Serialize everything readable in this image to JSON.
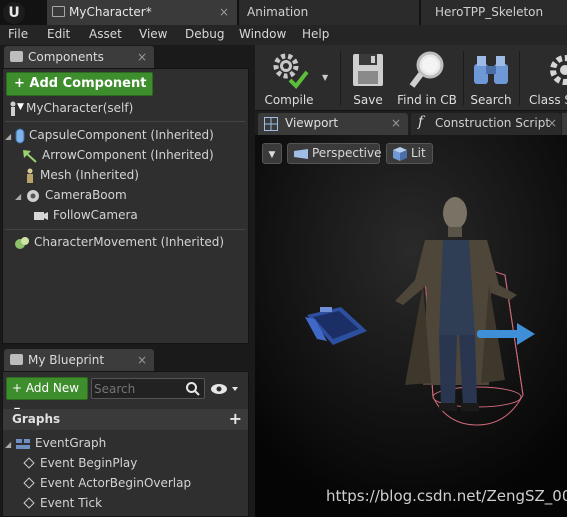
{
  "window": {
    "tabs": [
      {
        "label": "MyCharacter*",
        "active": true
      },
      {
        "label": "Animation",
        "active": false
      },
      {
        "label": "HeroTPP_Skeleton",
        "active": false
      }
    ],
    "logo": "U"
  },
  "menubar": {
    "items": [
      "File",
      "Edit",
      "Asset",
      "View",
      "Debug",
      "Window",
      "Help"
    ]
  },
  "components": {
    "title": "Components",
    "add_button": "+ Add Component",
    "items": [
      {
        "label": "MyCharacter(self)",
        "icon": "person-icon"
      },
      {
        "label": "CapsuleComponent (Inherited)",
        "icon": "capsule-icon"
      },
      {
        "label": "ArrowComponent (Inherited)",
        "icon": "arrow-icon"
      },
      {
        "label": "Mesh (Inherited)",
        "icon": "mesh-icon"
      },
      {
        "label": "CameraBoom",
        "icon": "camera-boom-icon"
      },
      {
        "label": "FollowCamera",
        "icon": "camera-icon"
      },
      {
        "label": "CharacterMovement (Inherited)",
        "icon": "movement-icon"
      }
    ]
  },
  "blueprint": {
    "title": "My Blueprint",
    "add_new": "+ Add New",
    "search_placeholder": "Search",
    "graphs_label": "Graphs",
    "graph_name": "EventGraph",
    "events": [
      "Event BeginPlay",
      "Event ActorBeginOverlap",
      "Event Tick"
    ]
  },
  "toolbar": {
    "buttons": [
      {
        "label": "Compile",
        "icon": "compile-gear-icon"
      },
      {
        "label": "Save",
        "icon": "save-disk-icon"
      },
      {
        "label": "Find in CB",
        "icon": "find-magnifier-icon"
      },
      {
        "label": "Search",
        "icon": "search-binoculars-icon"
      },
      {
        "label": "Class S",
        "icon": "class-settings-icon"
      }
    ]
  },
  "viewport": {
    "tabs": [
      {
        "label": "Viewport",
        "active": true
      },
      {
        "label": "Construction Script",
        "active": false
      }
    ],
    "perspective_label": "Perspective",
    "lit_label": "Lit",
    "watermark": "https://blog.csdn.net/ZengSZ_00"
  },
  "colors": {
    "accent_green": "#3f8e2d",
    "capsule_outline": "#d06a7a",
    "arrow_blue": "#3f8fd8"
  }
}
